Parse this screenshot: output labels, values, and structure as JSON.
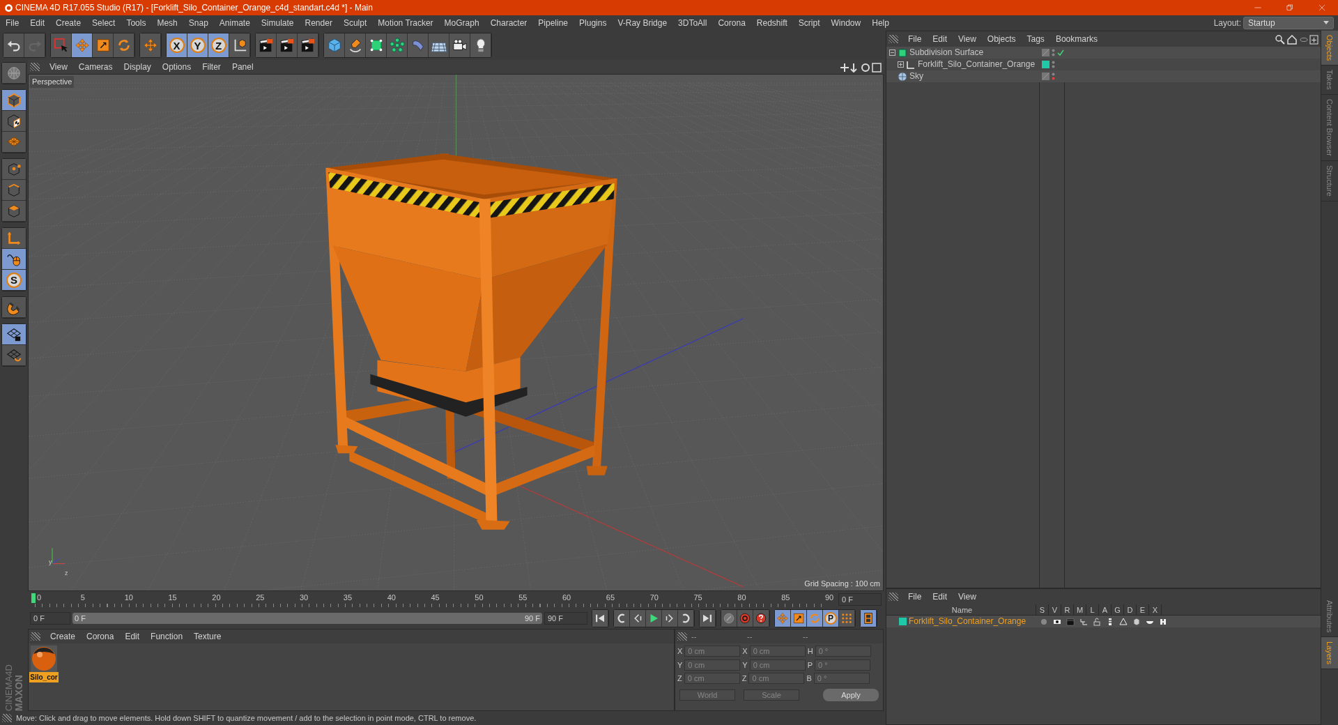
{
  "window": {
    "title": "CINEMA 4D R17.055 Studio (R17) - [Forklift_Silo_Container_Orange_c4d_standart.c4d *] - Main"
  },
  "menu": [
    "File",
    "Edit",
    "Create",
    "Select",
    "Tools",
    "Mesh",
    "Snap",
    "Animate",
    "Simulate",
    "Render",
    "Sculpt",
    "Motion Tracker",
    "MoGraph",
    "Character",
    "Pipeline",
    "Plugins",
    "V-Ray Bridge",
    "3DToAll",
    "Corona",
    "Redshift",
    "Script",
    "Window",
    "Help"
  ],
  "layout": {
    "label": "Layout:",
    "value": "Startup"
  },
  "toolbar": [
    [
      {
        "kind": "undo",
        "selected": false
      },
      {
        "kind": "redo",
        "selected": false
      }
    ],
    [
      {
        "kind": "select",
        "selected": false
      },
      {
        "kind": "move",
        "selected": true
      },
      {
        "kind": "scale",
        "selected": false
      },
      {
        "kind": "rotate",
        "selected": false
      }
    ],
    [
      {
        "kind": "move",
        "selected": false
      }
    ],
    [
      {
        "kind": "letter",
        "label": "X",
        "selected": true
      },
      {
        "kind": "letter",
        "label": "Y",
        "selected": true
      },
      {
        "kind": "letter",
        "label": "Z",
        "selected": true
      },
      {
        "kind": "coords",
        "selected": false
      }
    ],
    [
      {
        "kind": "render",
        "selected": false
      },
      {
        "kind": "render",
        "selected": false
      },
      {
        "kind": "render",
        "selected": false
      }
    ],
    [
      {
        "kind": "cube",
        "selected": false
      },
      {
        "kind": "pen",
        "selected": false
      },
      {
        "kind": "subdiv",
        "selected": false
      },
      {
        "kind": "cloner",
        "selected": false
      },
      {
        "kind": "bend",
        "selected": false
      },
      {
        "kind": "floor",
        "selected": false
      },
      {
        "kind": "camera",
        "selected": false
      },
      {
        "kind": "light",
        "selected": false
      }
    ]
  ],
  "left_tools": [
    [
      {
        "kind": "globe",
        "selected": false
      }
    ],
    [
      {
        "kind": "model",
        "selected": true
      },
      {
        "kind": "texture",
        "selected": false
      },
      {
        "kind": "workplane",
        "selected": false
      }
    ],
    [
      {
        "kind": "points",
        "selected": false
      },
      {
        "kind": "edges",
        "selected": false
      },
      {
        "kind": "polygons",
        "selected": false
      }
    ],
    [
      {
        "kind": "axis",
        "selected": false
      },
      {
        "kind": "tweak",
        "selected": true
      },
      {
        "kind": "letter",
        "label": "S",
        "selected": true
      }
    ],
    [
      {
        "kind": "magnet",
        "selected": false
      }
    ],
    [
      {
        "kind": "gridlock",
        "selected": true
      },
      {
        "kind": "gridsync",
        "selected": false
      }
    ]
  ],
  "brand": [
    "MAXON",
    "CINEMA4D"
  ],
  "viewport": {
    "menu": [
      "View",
      "Cameras",
      "Display",
      "Options",
      "Filter",
      "Panel"
    ],
    "camera": "Perspective",
    "grid_spacing": "Grid Spacing : 100 cm",
    "gizmo_labels": [
      "y",
      "z"
    ]
  },
  "timeline": {
    "ticks": [
      "0",
      "5",
      "10",
      "15",
      "20",
      "25",
      "30",
      "35",
      "40",
      "45",
      "50",
      "55",
      "60",
      "65",
      "70",
      "75",
      "80",
      "85",
      "90"
    ],
    "playhead": {
      "level": 0
    },
    "current": "0 F",
    "start": "0 F",
    "range": {
      "start": "0 F",
      "end": "90 F",
      "level": 1
    },
    "end": "90 F"
  },
  "transport": [
    [
      {
        "kind": "first"
      }
    ],
    [
      {
        "kind": "prevkey"
      },
      {
        "kind": "prev"
      },
      {
        "kind": "play"
      },
      {
        "kind": "next"
      },
      {
        "kind": "nextkey"
      }
    ],
    [
      {
        "kind": "last"
      }
    ],
    [
      {
        "kind": "keyoff"
      },
      {
        "kind": "record"
      },
      {
        "kind": "help"
      }
    ],
    [
      {
        "kind": "move",
        "selected": true
      },
      {
        "kind": "scale",
        "selected": true
      },
      {
        "kind": "rotate",
        "selected": true
      },
      {
        "kind": "letter",
        "label": "P",
        "selected": true
      },
      {
        "kind": "dots",
        "selected": false
      }
    ],
    [
      {
        "kind": "film",
        "selected": true
      }
    ]
  ],
  "materials": {
    "menu": [
      "Create",
      "Corona",
      "Edit",
      "Function",
      "Texture"
    ],
    "items": [
      {
        "name": "Silo_cor",
        "selected": true
      }
    ]
  },
  "coordinates": {
    "headers": [
      "--",
      "--",
      "--"
    ],
    "rows": [
      {
        "label_1": "X",
        "value_1": "0 cm",
        "label_2": "X",
        "value_2": "0 cm",
        "label_3": "H",
        "value_3": "0 °"
      },
      {
        "label_1": "Y",
        "value_1": "0 cm",
        "label_2": "Y",
        "value_2": "0 cm",
        "label_3": "P",
        "value_3": "0 °"
      },
      {
        "label_1": "Z",
        "value_1": "0 cm",
        "label_2": "Z",
        "value_2": "0 cm",
        "label_3": "B",
        "value_3": "0 °"
      }
    ],
    "space": "World",
    "mode": "Scale",
    "apply": "Apply"
  },
  "status_bar": "Move: Click and drag to move elements. Hold down SHIFT to quantize movement / add to the selection in point mode, CTRL to remove.",
  "objects": {
    "menu": [
      "File",
      "Edit",
      "View",
      "Objects",
      "Tags",
      "Bookmarks"
    ],
    "tree": [
      {
        "name": "Subdivision Surface",
        "kind": "subdiv",
        "expanded": true,
        "check": true,
        "render_off": false,
        "children": [
          {
            "name": "Forklift_Silo_Container_Orange",
            "kind": "null",
            "expanded": false,
            "check": false,
            "render_off": false,
            "color": "#1fc9a7"
          }
        ]
      },
      {
        "name": "Sky",
        "kind": "sky",
        "check": false,
        "render_off": true
      }
    ]
  },
  "layers": {
    "menu": [
      "File",
      "Edit",
      "View"
    ],
    "columns": [
      "Name",
      "S",
      "V",
      "R",
      "M",
      "L",
      "A",
      "G",
      "D",
      "E",
      "X"
    ],
    "rows": [
      {
        "name": "Forklift_Silo_Container_Orange",
        "color": "#1fc9a7"
      }
    ]
  },
  "side_tabs_top": [
    {
      "label": "Objects",
      "selected": true
    },
    {
      "label": "Takes",
      "selected": false
    },
    {
      "label": "Content Browser",
      "selected": false
    },
    {
      "label": "Structure",
      "selected": false
    }
  ],
  "side_tabs_bottom": [
    {
      "label": "Attributes",
      "selected": false
    },
    {
      "label": "Layers",
      "selected": true
    }
  ]
}
